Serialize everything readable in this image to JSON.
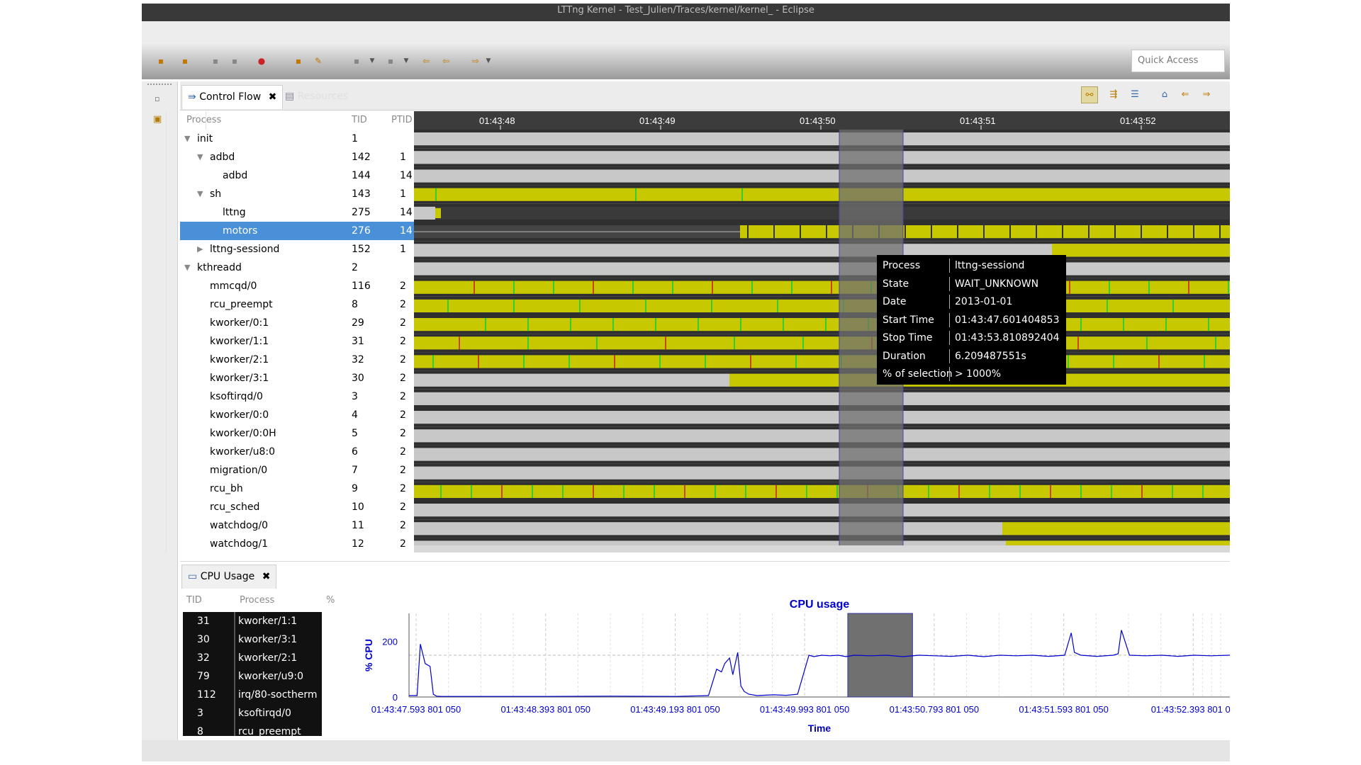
{
  "window": {
    "title": "LTTng Kernel - Test_Julien/Traces/kernel/kernel_ - Eclipse"
  },
  "quick_access": {
    "placeholder": "Quick Access"
  },
  "control_flow": {
    "tab_label": "Control Flow",
    "close_glyph": "✖",
    "inactive_tab_label": "Resources",
    "columns": {
      "process": "Process",
      "tid": "TID",
      "ptid": "PTID"
    },
    "time_ticks": [
      "01:43:48",
      "01:43:49",
      "01:43:50",
      "01:43:51",
      "01:43:52"
    ],
    "rows": [
      {
        "name": "init",
        "tid": "1",
        "ptid": "",
        "level": 0,
        "arrow": "▼"
      },
      {
        "name": "adbd",
        "tid": "142",
        "ptid": "1",
        "level": 1,
        "arrow": "▼"
      },
      {
        "name": "adbd",
        "tid": "144",
        "ptid": "14",
        "level": 2,
        "arrow": ""
      },
      {
        "name": "sh",
        "tid": "143",
        "ptid": "1",
        "level": 1,
        "arrow": "▼"
      },
      {
        "name": "lttng",
        "tid": "275",
        "ptid": "14",
        "level": 2,
        "arrow": ""
      },
      {
        "name": "motors",
        "tid": "276",
        "ptid": "14",
        "level": 2,
        "arrow": "",
        "selected": true
      },
      {
        "name": "lttng-sessiond",
        "tid": "152",
        "ptid": "1",
        "level": 1,
        "arrow": "▶"
      },
      {
        "name": "kthreadd",
        "tid": "2",
        "ptid": "",
        "level": 0,
        "arrow": "▼"
      },
      {
        "name": "mmcqd/0",
        "tid": "116",
        "ptid": "2",
        "level": 1,
        "arrow": ""
      },
      {
        "name": "rcu_preempt",
        "tid": "8",
        "ptid": "2",
        "level": 1,
        "arrow": ""
      },
      {
        "name": "kworker/0:1",
        "tid": "29",
        "ptid": "2",
        "level": 1,
        "arrow": ""
      },
      {
        "name": "kworker/1:1",
        "tid": "31",
        "ptid": "2",
        "level": 1,
        "arrow": ""
      },
      {
        "name": "kworker/2:1",
        "tid": "32",
        "ptid": "2",
        "level": 1,
        "arrow": ""
      },
      {
        "name": "kworker/3:1",
        "tid": "30",
        "ptid": "2",
        "level": 1,
        "arrow": ""
      },
      {
        "name": "ksoftirqd/0",
        "tid": "3",
        "ptid": "2",
        "level": 1,
        "arrow": ""
      },
      {
        "name": "kworker/0:0",
        "tid": "4",
        "ptid": "2",
        "level": 1,
        "arrow": ""
      },
      {
        "name": "kworker/0:0H",
        "tid": "5",
        "ptid": "2",
        "level": 1,
        "arrow": ""
      },
      {
        "name": "kworker/u8:0",
        "tid": "6",
        "ptid": "2",
        "level": 1,
        "arrow": ""
      },
      {
        "name": "migration/0",
        "tid": "7",
        "ptid": "2",
        "level": 1,
        "arrow": ""
      },
      {
        "name": "rcu_bh",
        "tid": "9",
        "ptid": "2",
        "level": 1,
        "arrow": ""
      },
      {
        "name": "rcu_sched",
        "tid": "10",
        "ptid": "2",
        "level": 1,
        "arrow": ""
      },
      {
        "name": "watchdog/0",
        "tid": "11",
        "ptid": "2",
        "level": 1,
        "arrow": ""
      },
      {
        "name": "watchdog/1",
        "tid": "12",
        "ptid": "2",
        "level": 1,
        "arrow": ""
      }
    ],
    "state_colors": {
      "running": "#c8c800",
      "waiting": "#c8c8c8",
      "unknown": "#3a3a3a",
      "syscall": "#33cc33",
      "interrupt": "#cc4422",
      "selection": "#707070",
      "header": "#3c3c3c"
    },
    "tooltip": [
      {
        "key": "Process",
        "value": "lttng-sessiond"
      },
      {
        "key": "State",
        "value": "WAIT_UNKNOWN"
      },
      {
        "key": "Date",
        "value": "2013-01-01"
      },
      {
        "key": "Start Time",
        "value": "01:43:47.601404853"
      },
      {
        "key": "Stop Time",
        "value": "01:43:53.810892404"
      },
      {
        "key": "Duration",
        "value": "6.209487551s"
      },
      {
        "key": "% of selection",
        "value": "> 1000%"
      }
    ]
  },
  "cpu_usage": {
    "tab_label": "CPU Usage",
    "close_glyph": "✖",
    "columns": {
      "tid": "TID",
      "process": "Process",
      "percent": "%"
    },
    "rows": [
      {
        "tid": "31",
        "process": "kworker/1:1"
      },
      {
        "tid": "30",
        "process": "kworker/3:1"
      },
      {
        "tid": "32",
        "process": "kworker/2:1"
      },
      {
        "tid": "79",
        "process": "kworker/u9:0"
      },
      {
        "tid": "112",
        "process": "irq/80-soctherm"
      },
      {
        "tid": "3",
        "process": "ksoftirqd/0"
      },
      {
        "tid": "8",
        "process": "rcu_preempt"
      }
    ]
  },
  "chart_data": {
    "type": "line",
    "title": "CPU usage",
    "xlabel": "Time",
    "ylabel": "% CPU",
    "ylim": [
      0,
      300
    ],
    "yticks": [
      "0",
      "200"
    ],
    "xticks": [
      "01:43:47.593 801 050",
      "01:43:48.393 801 050",
      "01:43:49.193 801 050",
      "01:43:49.993 801 050",
      "01:43:50.793 801 050",
      "01:43:51.593 801 050",
      "01:43:52.393 801 05"
    ],
    "grid": true,
    "series_color": "#0000cc",
    "selection_seconds": [
      50.26,
      50.66
    ],
    "series": [
      {
        "x": [
          47.55,
          47.6,
          47.62,
          47.65,
          47.68,
          47.7,
          47.72,
          47.75,
          47.8,
          48.0,
          48.4,
          48.8,
          49.2,
          49.4,
          49.45,
          49.48,
          49.5,
          49.53,
          49.55,
          49.58,
          49.6,
          49.62,
          49.65,
          49.7,
          49.8,
          49.88,
          49.95,
          50.0,
          50.02,
          50.05,
          50.1,
          50.15,
          50.2,
          50.25,
          50.3,
          50.4,
          50.5,
          50.6,
          50.7,
          50.8,
          50.9,
          51.0,
          51.1,
          51.2,
          51.3,
          51.4,
          51.5,
          51.6,
          51.64,
          51.66,
          51.7,
          51.8,
          51.9,
          51.93,
          51.95,
          52.0,
          52.1,
          52.2,
          52.3,
          52.4,
          52.5,
          52.62
        ],
        "y": [
          5,
          5,
          190,
          120,
          110,
          10,
          3,
          2,
          2,
          2,
          2,
          3,
          2,
          5,
          100,
          90,
          120,
          140,
          80,
          160,
          40,
          20,
          10,
          5,
          8,
          6,
          10,
          110,
          150,
          145,
          150,
          148,
          150,
          145,
          150,
          148,
          150,
          145,
          150,
          148,
          146,
          150,
          145,
          150,
          148,
          150,
          146,
          150,
          230,
          160,
          150,
          146,
          150,
          155,
          240,
          150,
          148,
          150,
          146,
          150,
          148,
          150
        ]
      }
    ]
  }
}
